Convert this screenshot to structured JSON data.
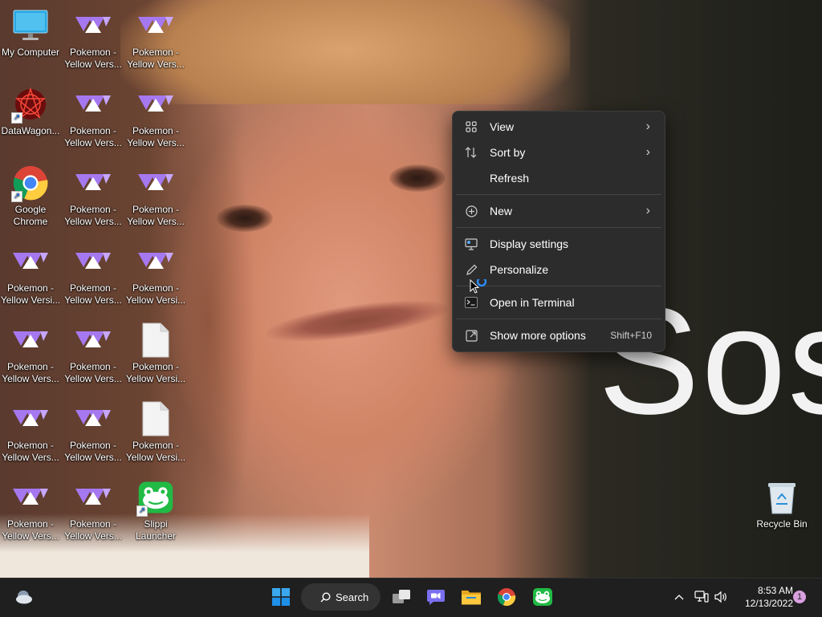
{
  "desktop": {
    "icons": [
      {
        "label": "My Computer",
        "icon": "monitor-icon"
      },
      {
        "label": "Pokemon -\nYellow Vers...",
        "icon": "pokemon-rom-icon"
      },
      {
        "label": "Pokemon -\nYellow Vers...",
        "icon": "pokemon-rom-icon"
      },
      {
        "label": "DataWagon...",
        "icon": "datawagon-icon"
      },
      {
        "label": "Pokemon -\nYellow Vers...",
        "icon": "pokemon-rom-icon"
      },
      {
        "label": "Pokemon -\nYellow Vers...",
        "icon": "pokemon-rom-icon"
      },
      {
        "label": "Google\nChrome",
        "icon": "chrome-icon"
      },
      {
        "label": "Pokemon -\nYellow Vers...",
        "icon": "pokemon-rom-icon"
      },
      {
        "label": "Pokemon -\nYellow Vers...",
        "icon": "pokemon-rom-icon"
      },
      {
        "label": "Pokemon -\nYellow Versi...",
        "icon": "pokemon-rom-icon"
      },
      {
        "label": "Pokemon -\nYellow Vers...",
        "icon": "pokemon-rom-icon"
      },
      {
        "label": "Pokemon -\nYellow Versi...",
        "icon": "pokemon-rom-icon"
      },
      {
        "label": "Pokemon -\nYellow Vers...",
        "icon": "pokemon-rom-icon"
      },
      {
        "label": "Pokemon -\nYellow Vers...",
        "icon": "pokemon-rom-icon"
      },
      {
        "label": "Pokemon -\nYellow Versi...",
        "icon": "file-icon"
      },
      {
        "label": "Pokemon -\nYellow Vers...",
        "icon": "pokemon-rom-icon"
      },
      {
        "label": "Pokemon -\nYellow Vers...",
        "icon": "pokemon-rom-icon"
      },
      {
        "label": "Pokemon -\nYellow Versi...",
        "icon": "file-icon"
      },
      {
        "label": "Pokemon -\nYellow Vers...",
        "icon": "pokemon-rom-icon"
      },
      {
        "label": "Pokemon -\nYellow Vers...",
        "icon": "pokemon-rom-icon"
      },
      {
        "label": "Slippi\nLauncher",
        "icon": "slippi-frog-icon"
      },
      {
        "label": "Recycle Bin",
        "icon": "recycle-bin-icon"
      }
    ],
    "wallpaper_text": "Sos"
  },
  "context_menu": {
    "items": [
      {
        "label": "View",
        "icon": "grid-view-icon",
        "submenu": true
      },
      {
        "label": "Sort by",
        "icon": "sort-icon",
        "submenu": true
      },
      {
        "label": "Refresh",
        "icon": "refresh-icon",
        "submenu": false
      },
      {
        "label": "New",
        "icon": "plus-circle-icon",
        "submenu": true
      },
      {
        "label": "Display settings",
        "icon": "display-settings-icon",
        "submenu": false
      },
      {
        "label": "Personalize",
        "icon": "pen-icon",
        "submenu": false
      },
      {
        "label": "Open in Terminal",
        "icon": "terminal-icon",
        "submenu": false
      },
      {
        "label": "Show more options",
        "icon": "open-external-icon",
        "submenu": false,
        "shortcut": "Shift+F10"
      }
    ]
  },
  "taskbar": {
    "search_label": "Search",
    "apps": [
      "widgets-weather-icon",
      "windows-start-icon",
      "task-view-icon",
      "teams-chat-icon",
      "file-explorer-icon",
      "chrome-icon",
      "slippi-frog-icon"
    ],
    "tray": [
      "chevron-up-icon",
      "network-icon",
      "volume-icon"
    ],
    "time": "8:53 AM",
    "date": "12/13/2022",
    "notification_count": "1"
  },
  "colors": {
    "menu_bg": "#2c2c2c",
    "taskbar_bg": "#1f1f1f",
    "pokemon_purple": "#a678f0",
    "accent_blue": "#0078d4"
  }
}
